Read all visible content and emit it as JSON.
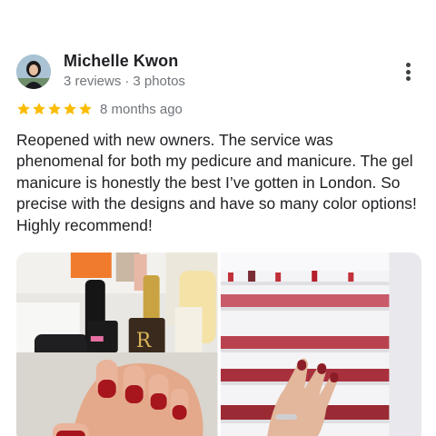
{
  "review": {
    "author_name": "Michelle Kwon",
    "reviews_count": "3 reviews",
    "separator": "·",
    "photos_count": "3 photos",
    "rating": 5,
    "rating_max": 5,
    "time_ago": "8 months ago",
    "text": "Reopened with new owners. The service was phenomenal for both my pedicure and manicure. The gel manicure is honestly the best I’ve gotten in London. So precise with the designs and have so many color options! Highly recommend!",
    "more_icon": "more-vertical-icon",
    "star_icon": "star-icon",
    "star_color": "#fbbc04"
  },
  "photos": [
    {
      "name": "nail-photo-manicure",
      "description_icon": "photo-thumbnail"
    },
    {
      "name": "nail-photo-polish-wall",
      "description_icon": "photo-thumbnail"
    }
  ]
}
